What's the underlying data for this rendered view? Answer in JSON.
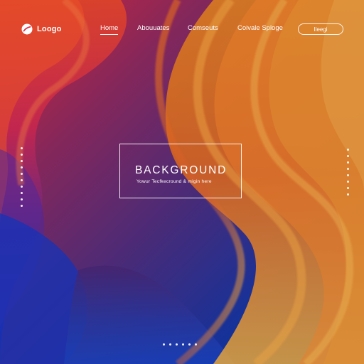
{
  "header": {
    "logo_text": "Loogo",
    "nav": {
      "home": "Home",
      "about": "Abouuates",
      "contacts": "Comseuts",
      "create": "Coivale Splоge"
    },
    "cta_label": "Ileegi"
  },
  "hero": {
    "title": "BACKGROUND",
    "subtitle": "Yowur Tecfkecround & migin here"
  },
  "pagination": {
    "left_dots": 10,
    "right_dots": 8,
    "bottom_dots": 6
  },
  "colors": {
    "red": "#e62f4b",
    "orange": "#f28a1e",
    "purple": "#7c2d75",
    "blue": "#1f3fb4",
    "accent_line": "#ffffff"
  }
}
